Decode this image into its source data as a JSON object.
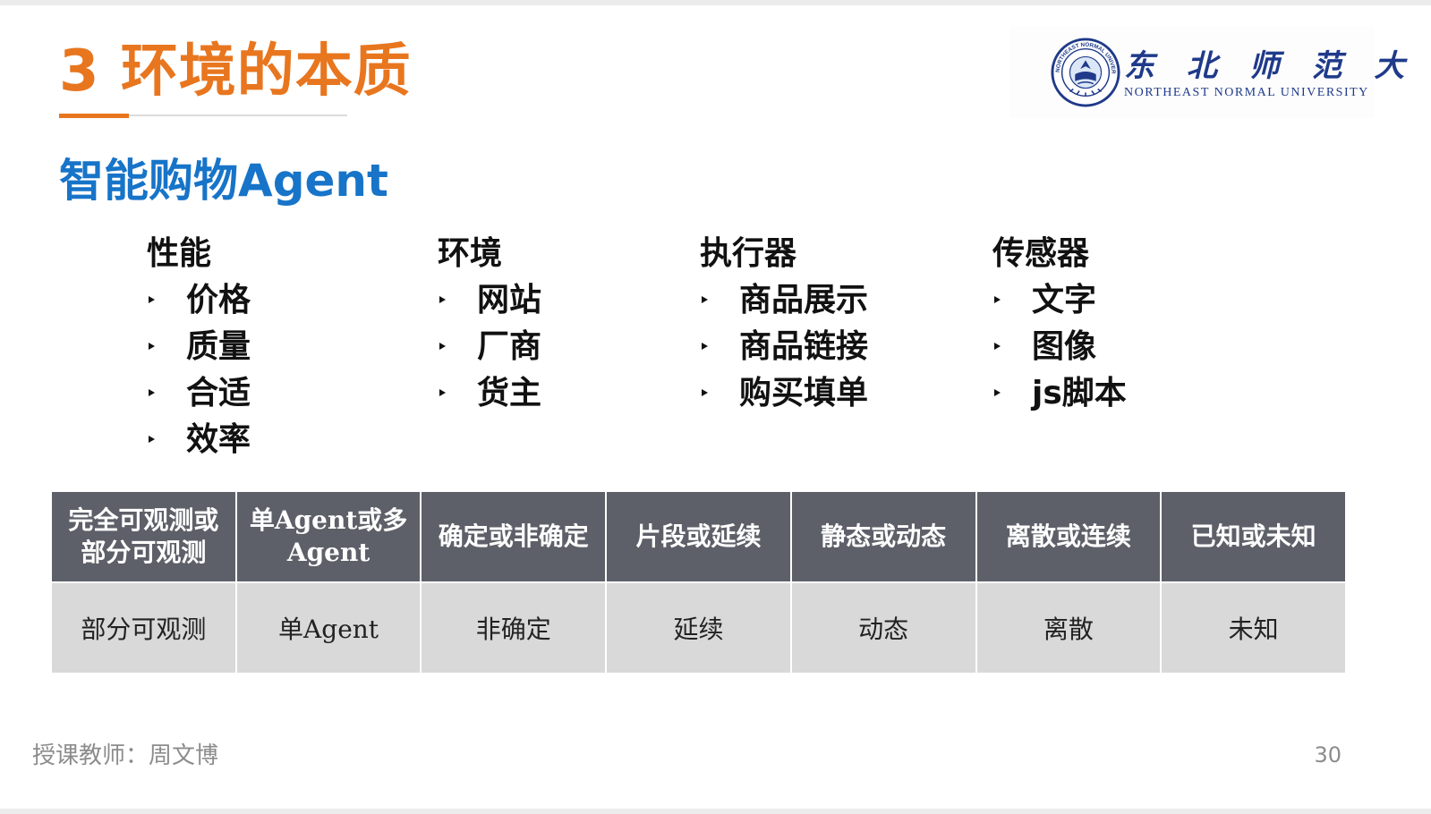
{
  "header": {
    "title": "3 环境的本质",
    "logo": {
      "name_cn": "东 北 师 范 大 学",
      "name_en": "NORTHEAST NORMAL UNIVERSITY",
      "seal_text": "NORTHEAST NORMAL UNIVERSITY",
      "seal_icon": "university-seal-icon"
    }
  },
  "colors": {
    "title": "#e8761f",
    "subtitle": "#1774c8",
    "table_header_bg": "#5d6068",
    "table_cell_bg": "#d9d9d9",
    "logo": "#1f3a8a"
  },
  "subtitle": "智能购物Agent",
  "peas": [
    {
      "heading": "性能",
      "items": [
        "价格",
        "质量",
        "合适",
        "效率"
      ]
    },
    {
      "heading": "环境",
      "items": [
        "网站",
        "厂商",
        "货主"
      ]
    },
    {
      "heading": "执行器",
      "items": [
        "商品展示",
        "商品链接",
        "购买填单"
      ]
    },
    {
      "heading": "传感器",
      "items": [
        "文字",
        "图像",
        "js脚本"
      ]
    }
  ],
  "env_table": {
    "headers": [
      [
        "完全可观测或",
        "部分可观测"
      ],
      [
        "单Agent或多",
        "Agent"
      ],
      [
        "确定或非确定"
      ],
      [
        "片段或延续"
      ],
      [
        "静态或动态"
      ],
      [
        "离散或连续"
      ],
      [
        "已知或未知"
      ]
    ],
    "values": [
      "部分可观测",
      "单Agent",
      "非确定",
      "延续",
      "动态",
      "离散",
      "未知"
    ]
  },
  "footer": {
    "instructor": "授课教师：周文博",
    "page_number": "30"
  }
}
